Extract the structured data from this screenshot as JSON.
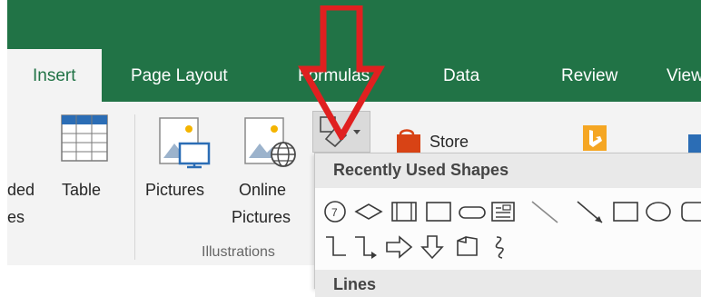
{
  "tabs": {
    "insert": "Insert",
    "page_layout": "Page Layout",
    "formulas": "Formulas",
    "data": "Data",
    "review": "Review",
    "view": "View"
  },
  "ribbon": {
    "recommended_partial_1": "ded",
    "recommended_partial_2": "es",
    "table": "Table",
    "pictures": "Pictures",
    "online_pictures_1": "Online",
    "online_pictures_2": "Pictures",
    "illustrations_group": "Illustrations",
    "store": "Store"
  },
  "shapes_menu": {
    "recently_used_title": "Recently Used Shapes",
    "lines_title": "Lines"
  },
  "colors": {
    "excel_green": "#217346",
    "annotation_red": "#e02020"
  }
}
